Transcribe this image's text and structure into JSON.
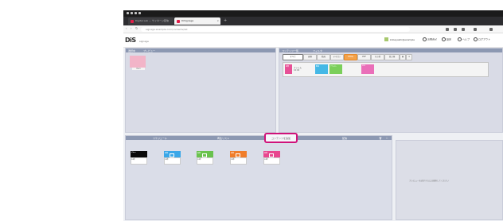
{
  "browser": {
    "tabs": [
      {
        "title": "Digital Lab — サイネージ配信"
      },
      {
        "title": "DiSignage"
      }
    ],
    "url": "signage.example.com/contents/list"
  },
  "app": {
    "logo": "DiS",
    "logo_sub": "signage",
    "user": "kobayashi@example",
    "links": [
      "お問合せ",
      "設定",
      "ヘルプ",
      "ログアウト"
    ]
  },
  "panels": {
    "tl": {
      "title": "選択中",
      "subtitle": "プレビュー",
      "selected_label": "Item"
    },
    "tr": {
      "title": "コンテンツ一覧",
      "subtitle": "フィルタ",
      "chips": [
        "すべて",
        "画像",
        "動画",
        "テキスト",
        "HTML",
        "PDF",
        "その他",
        "並び順"
      ],
      "active_chip_index": 4
    },
    "bl": {
      "title_left": "スケジュール",
      "title_mid": "再生リスト",
      "title_right": "配信",
      "highlight_button": "コンテンツを追加"
    },
    "br": {
      "empty_text": "プレビューを表示するには選択してください"
    }
  },
  "tray_cards": [
    {
      "label": "画像",
      "color": "#e75096"
    },
    {
      "label": "動画",
      "color": "#45b8e6"
    },
    {
      "label": "テキスト",
      "color": "#7bcf5a"
    },
    {
      "label": "PDF",
      "color": "#ea6fb9"
    }
  ],
  "playlist_cards": [
    {
      "label": "Video",
      "sub": "10秒",
      "color": "#0a0a0a"
    },
    {
      "label": "画像",
      "sub": "10秒",
      "color": "#3aa7e8"
    },
    {
      "label": "画像",
      "sub": "10秒",
      "color": "#69c24d"
    },
    {
      "label": "画像",
      "sub": "10秒",
      "color": "#f07d2a"
    },
    {
      "label": "画像",
      "sub": "10秒",
      "color": "#e8478f"
    }
  ]
}
